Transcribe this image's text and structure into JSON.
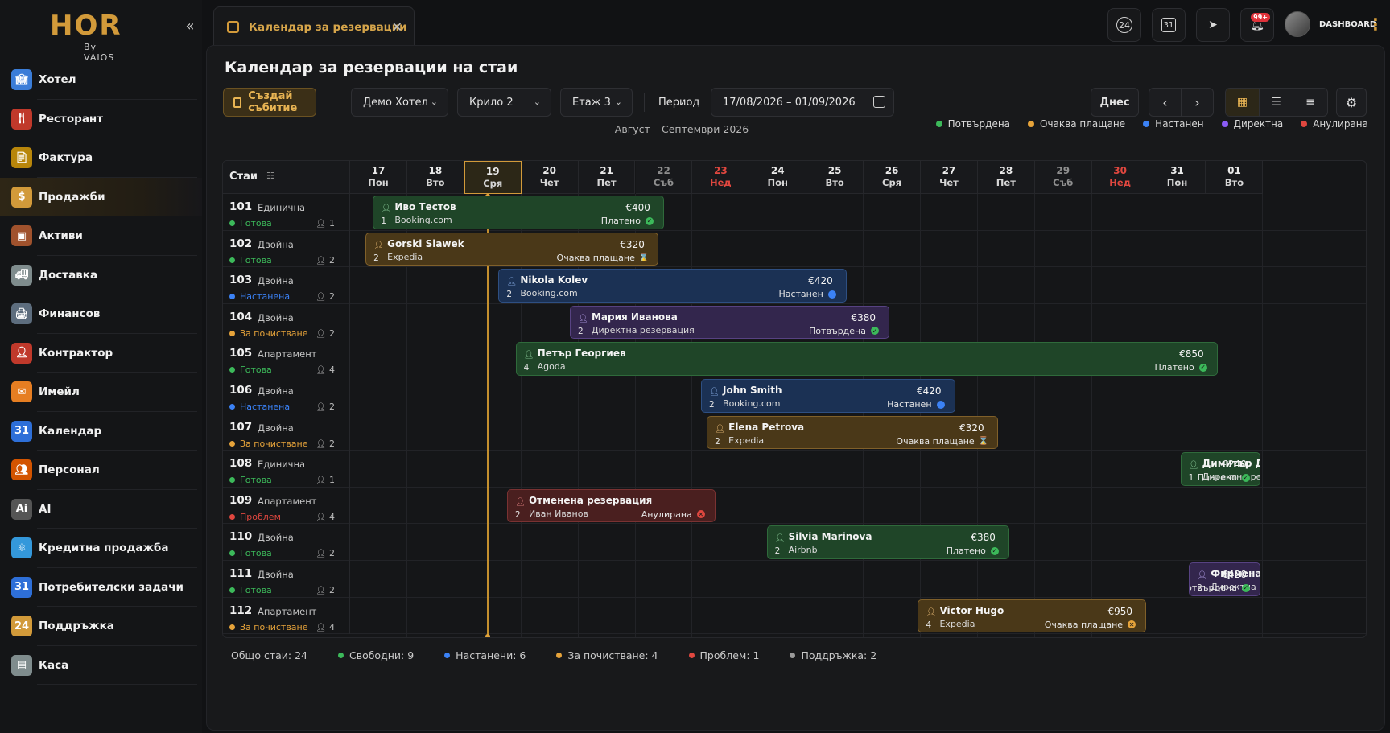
{
  "brand": {
    "logo": "HOR",
    "sub": "By VAIOS"
  },
  "sidebar": {
    "items": [
      {
        "label": "Хотел",
        "icon": "hotel-icon",
        "color": "#3b7dd8"
      },
      {
        "label": "Ресторант",
        "icon": "restaurant-icon",
        "color": "#c0392b"
      },
      {
        "label": "Фактура",
        "icon": "invoice-icon",
        "color": "#b8860b"
      },
      {
        "label": "Продажби",
        "icon": "sales-icon",
        "color": "#d29a3a",
        "active": true
      },
      {
        "label": "Активи",
        "icon": "assets-icon",
        "color": "#a0522d"
      },
      {
        "label": "Доставка",
        "icon": "delivery-icon",
        "color": "#7f8c8d"
      },
      {
        "label": "Финансов",
        "icon": "finance-icon",
        "color": "#5d6d7e"
      },
      {
        "label": "Контрактор",
        "icon": "contractor-icon",
        "color": "#c0392b"
      },
      {
        "label": "Имейл",
        "icon": "mail-icon",
        "color": "#e67e22"
      },
      {
        "label": "Календар",
        "icon": "calendar-icon",
        "color": "#2e6fd8"
      },
      {
        "label": "Персонал",
        "icon": "staff-icon",
        "color": "#d35400"
      },
      {
        "label": "AI",
        "icon": "ai-icon",
        "color": "#555555"
      },
      {
        "label": "Кредитна продажба",
        "icon": "credit-icon",
        "color": "#3498db"
      },
      {
        "label": "Потребителски задачи",
        "icon": "tasks-icon",
        "color": "#2e6fd8"
      },
      {
        "label": "Поддръжка",
        "icon": "support-icon",
        "color": "#d29a3a"
      },
      {
        "label": "Каса",
        "icon": "cashier-icon",
        "color": "#7f8c8d"
      }
    ]
  },
  "tab": {
    "label": "Календар за резервации"
  },
  "header": {
    "badge": "99+",
    "user_label": "DASHBOARD",
    "support_badge": "24",
    "cal_badge": "31"
  },
  "page": {
    "title": "Календар за резервации на стаи",
    "create_label": "Създай събитие",
    "hotel": "Демо Хотел",
    "wing": "Крило 2",
    "floor": "Етаж 3",
    "period_label": "Период",
    "period_value": "17/08/2026 – 01/09/2026",
    "today_label": "Днес",
    "month_label": "Август – Септември 2026"
  },
  "legend": [
    {
      "label": "Потвърдена",
      "color": "#3cb95a"
    },
    {
      "label": "Очаква плащане",
      "color": "#e6a33a"
    },
    {
      "label": "Настанен",
      "color": "#3b82f6"
    },
    {
      "label": "Директна",
      "color": "#8b5cf6"
    },
    {
      "label": "Анулирана",
      "color": "#e0473f"
    }
  ],
  "grid": {
    "rooms_label": "Стаи",
    "days": [
      {
        "d": "17",
        "w": "Пон"
      },
      {
        "d": "18",
        "w": "Вто"
      },
      {
        "d": "19",
        "w": "Сря",
        "today": true
      },
      {
        "d": "20",
        "w": "Чет"
      },
      {
        "d": "21",
        "w": "Пет"
      },
      {
        "d": "22",
        "w": "Съб",
        "sat": true
      },
      {
        "d": "23",
        "w": "Нед",
        "sun": true
      },
      {
        "d": "24",
        "w": "Пон"
      },
      {
        "d": "25",
        "w": "Вто"
      },
      {
        "d": "26",
        "w": "Сря"
      },
      {
        "d": "27",
        "w": "Чет"
      },
      {
        "d": "28",
        "w": "Пет"
      },
      {
        "d": "29",
        "w": "Съб",
        "sat": true
      },
      {
        "d": "30",
        "w": "Нед",
        "sun": true
      },
      {
        "d": "31",
        "w": "Пон"
      },
      {
        "d": "01",
        "w": "Вто"
      }
    ],
    "rooms": [
      {
        "num": "101",
        "type": "Единична",
        "status": "Готова",
        "color": "#3cb95a",
        "cap": "1"
      },
      {
        "num": "102",
        "type": "Двойна",
        "status": "Готова",
        "color": "#3cb95a",
        "cap": "2"
      },
      {
        "num": "103",
        "type": "Двойна",
        "status": "Настанена",
        "color": "#3b82f6",
        "cap": "2"
      },
      {
        "num": "104",
        "type": "Двойна",
        "status": "За почистване",
        "color": "#e6a33a",
        "cap": "2"
      },
      {
        "num": "105",
        "type": "Апартамент",
        "status": "Готова",
        "color": "#3cb95a",
        "cap": "4"
      },
      {
        "num": "106",
        "type": "Двойна",
        "status": "Настанена",
        "color": "#3b82f6",
        "cap": "2"
      },
      {
        "num": "107",
        "type": "Двойна",
        "status": "За почистване",
        "color": "#e6a33a",
        "cap": "2"
      },
      {
        "num": "108",
        "type": "Единична",
        "status": "Готова",
        "color": "#3cb95a",
        "cap": "1"
      },
      {
        "num": "109",
        "type": "Апартамент",
        "status": "Проблем",
        "color": "#e0473f",
        "cap": "4"
      },
      {
        "num": "110",
        "type": "Двойна",
        "status": "Готова",
        "color": "#3cb95a",
        "cap": "2"
      },
      {
        "num": "111",
        "type": "Двойна",
        "status": "Готова",
        "color": "#3cb95a",
        "cap": "2"
      },
      {
        "num": "112",
        "type": "Апартамент",
        "status": "За почистване",
        "color": "#e6a33a",
        "cap": "4"
      }
    ],
    "bookings": [
      {
        "row": 0,
        "start": 0.4,
        "end": 5.5,
        "kind": "green",
        "name": "Иво Тестов",
        "src": "Booking.com",
        "guests": "1",
        "price": "€400",
        "pay": "Платено",
        "st": "check"
      },
      {
        "row": 1,
        "start": 0.27,
        "end": 5.4,
        "kind": "orange",
        "name": "Gorski Slawek",
        "src": "Expedia",
        "guests": "2",
        "price": "€320",
        "pay": "Очаква плащане",
        "st": "hourglass"
      },
      {
        "row": 2,
        "start": 2.6,
        "end": 8.7,
        "kind": "blue",
        "name": "Nikola Kolev",
        "src": "Booking.com",
        "guests": "2",
        "price": "€420",
        "pay": "Настанен",
        "st": "dot"
      },
      {
        "row": 3,
        "start": 3.85,
        "end": 9.45,
        "kind": "purple",
        "name": "Мария Иванова",
        "src": "Директна резервация",
        "guests": "2",
        "price": "€380",
        "pay": "Потвърдена",
        "st": "check"
      },
      {
        "row": 4,
        "start": 2.9,
        "end": 15.2,
        "kind": "green",
        "name": "Петър Георгиев",
        "src": "Agoda",
        "guests": "4",
        "price": "€850",
        "pay": "Платено",
        "st": "check"
      },
      {
        "row": 5,
        "start": 6.15,
        "end": 10.6,
        "kind": "blue",
        "name": "John Smith",
        "src": "Booking.com",
        "guests": "2",
        "price": "€420",
        "pay": "Настанен",
        "st": "dot"
      },
      {
        "row": 6,
        "start": 6.25,
        "end": 11.35,
        "kind": "orange",
        "name": "Elena Petrova",
        "src": "Expedia",
        "guests": "2",
        "price": "€320",
        "pay": "Очаква плащане",
        "st": "hourglass"
      },
      {
        "row": 7,
        "start": 14.55,
        "end": 15.95,
        "kind": "green",
        "name": "Димитър Димитров",
        "src": "Директна резервация",
        "guests": "1",
        "price": "€240",
        "pay": "Платено",
        "st": "check"
      },
      {
        "row": 8,
        "start": 2.75,
        "end": 6.4,
        "kind": "red",
        "name": "Отменена резервация",
        "src": "Иван Иванов",
        "guests": "2",
        "price": "",
        "pay": "Анулирана",
        "st": "x"
      },
      {
        "row": 9,
        "start": 7.3,
        "end": 11.55,
        "kind": "green",
        "name": "Silvia Marinova",
        "src": "Airbnb",
        "guests": "2",
        "price": "€380",
        "pay": "Платено",
        "st": "check"
      },
      {
        "row": 10,
        "start": 14.7,
        "end": 15.95,
        "kind": "purple",
        "name": "Фирмена резервация",
        "src": "Директна",
        "guests": "2",
        "price": "€420",
        "pay": "Потвърдена",
        "st": "check"
      },
      {
        "row": 11,
        "start": 9.95,
        "end": 13.95,
        "kind": "orange",
        "name": "Victor Hugo",
        "src": "Expedia",
        "guests": "4",
        "price": "€950",
        "pay": "Очаква плащане",
        "st": "x-orange"
      }
    ]
  },
  "footer": {
    "total": "Общо стаи: 24",
    "items": [
      {
        "label": "Свободни: 9",
        "color": "#3cb95a"
      },
      {
        "label": "Настанени: 6",
        "color": "#3b82f6"
      },
      {
        "label": "За почистване: 4",
        "color": "#e6a33a"
      },
      {
        "label": "Проблем: 1",
        "color": "#e0473f"
      },
      {
        "label": "Поддръжка: 2",
        "color": "#9a9a9a"
      }
    ]
  }
}
